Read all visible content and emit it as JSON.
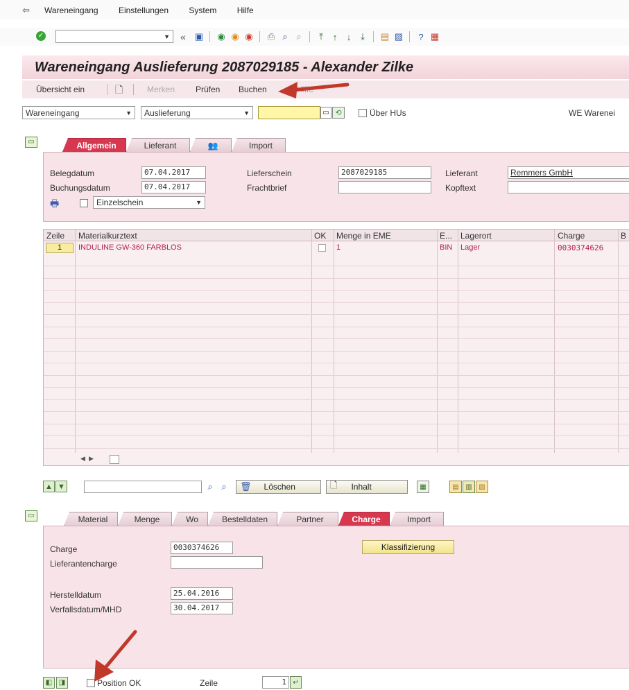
{
  "menu": [
    "Wareneingang",
    "Einstellungen",
    "System",
    "Hilfe"
  ],
  "title": "Wareneingang Auslieferung 2087029185 - Alexander Zilke",
  "app_toolbar": {
    "overview": "Übersicht ein",
    "flag": "Merken",
    "check": "Prüfen",
    "post": "Buchen",
    "help": "Hilfe"
  },
  "selector": {
    "action": "Wareneingang",
    "reference": "Auslieferung",
    "reference_value": "",
    "hu_label": "Über HUs",
    "right_label": "WE Warenei"
  },
  "header_tabs": [
    "Allgemein",
    "Lieferant",
    "",
    "Import"
  ],
  "header": {
    "doc_date_label": "Belegdatum",
    "doc_date": "07.04.2017",
    "post_date_label": "Buchungsdatum",
    "post_date": "07.04.2017",
    "print_option": "Einzelschein",
    "delivery_note_label": "Lieferschein",
    "delivery_note": "2087029185",
    "bill_label": "Frachtbrief",
    "bill": "",
    "vendor_label": "Lieferant",
    "vendor": "Remmers GmbH",
    "header_text_label": "Kopftext",
    "header_text": ""
  },
  "grid": {
    "columns": {
      "line": "Zeile",
      "material": "Materialkurztext",
      "ok": "OK",
      "qty": "Menge in EME",
      "unit": "E...",
      "storage": "Lagerort",
      "batch": "Charge",
      "extra": "B"
    },
    "rows": [
      {
        "line": "1",
        "material": "INDULINE GW-360 FARBLOS",
        "qty": "1",
        "unit": "BIN",
        "storage": "Lager",
        "batch": "0030374626"
      }
    ],
    "empty_rows": 16
  },
  "grid_toolbar": {
    "search_value": "",
    "delete": "Löschen",
    "content": "Inhalt"
  },
  "item_tabs": [
    "Material",
    "Menge",
    "Wo",
    "Bestelldaten",
    "Partner",
    "Charge",
    "Import"
  ],
  "item": {
    "batch_label": "Charge",
    "batch": "0030374626",
    "vendor_batch_label": "Lieferantencharge",
    "vendor_batch": "",
    "classify_button": "Klassifizierung",
    "mfg_date_label": "Herstelldatum",
    "mfg_date": "25.04.2016",
    "exp_date_label": "Verfallsdatum/MHD",
    "exp_date": "30.04.2017"
  },
  "footer": {
    "position_ok": "Position OK",
    "line_label": "Zeile",
    "line_value": "1"
  },
  "colors": {
    "title_bg": "#f5dde2",
    "panel_bg": "#f8e3e8",
    "accent": "#d73850",
    "arrow": "#c0392b"
  }
}
